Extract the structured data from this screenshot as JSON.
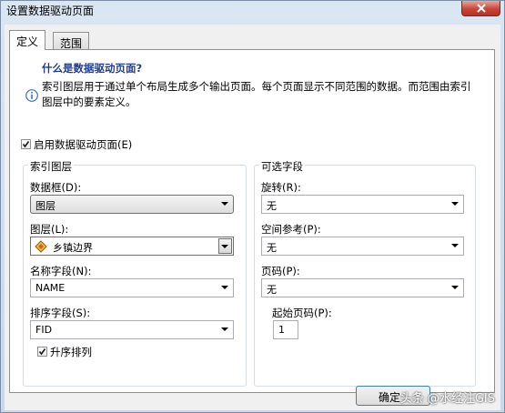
{
  "window": {
    "title": "设置数据驱动页面"
  },
  "tabs": [
    {
      "label": "定义"
    },
    {
      "label": "范围"
    }
  ],
  "info": {
    "heading": "什么是数据驱动页面?",
    "description": "索引图层用于通过单个布局生成多个输出页面。每个页面显示不同范围的数据。而范围由索引图层中的要素定义。"
  },
  "enable_checkbox": {
    "label": "启用数据驱动页面(E)",
    "checked": true
  },
  "index_group": {
    "title": "索引图层",
    "data_frame": {
      "label": "数据框(D):",
      "value": "图层"
    },
    "layer": {
      "label": "图层(L):",
      "value": "乡镇边界"
    },
    "name_field": {
      "label": "名称字段(N):",
      "value": "NAME"
    },
    "sort_field": {
      "label": "排序字段(S):",
      "value": "FID"
    },
    "ascending": {
      "label": "升序排列",
      "checked": true
    }
  },
  "optional_group": {
    "title": "可选字段",
    "rotation": {
      "label": "旋转(R):",
      "value": "无"
    },
    "spatial_ref": {
      "label": "空间参考(P):",
      "value": "无"
    },
    "page_number": {
      "label": "页码(P):",
      "value": "无"
    },
    "start_page": {
      "label": "起始页码(P):",
      "value": "1"
    }
  },
  "buttons": {
    "ok": "确定"
  },
  "watermark": "头条 @水经注GIS",
  "colors": {
    "heading": "#1e3c96",
    "close": "#c7473a"
  }
}
